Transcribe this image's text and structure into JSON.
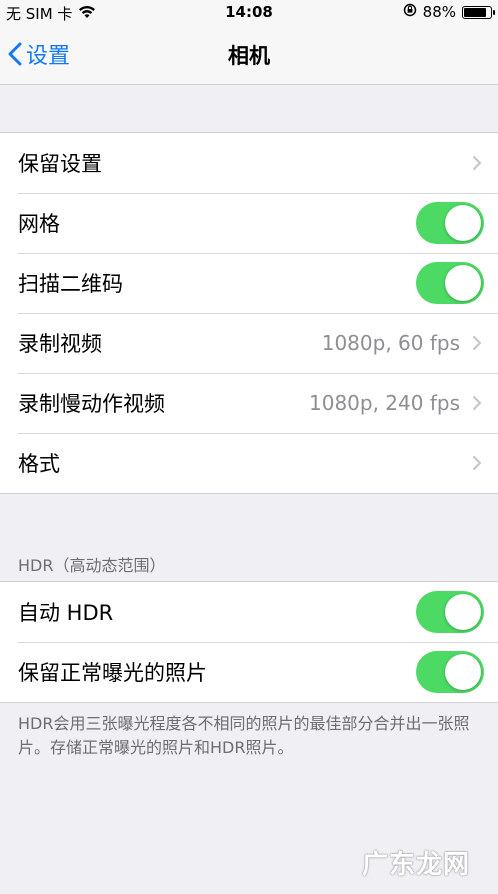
{
  "status": {
    "carrier": "无 SIM 卡",
    "time": "14:08",
    "battery": "88%",
    "battery_level": 0.88
  },
  "nav": {
    "back_label": "设置",
    "title": "相机"
  },
  "group1": {
    "rows": [
      {
        "label": "保留设置"
      },
      {
        "label": "网格",
        "on": true
      },
      {
        "label": "扫描二维码",
        "on": true
      },
      {
        "label": "录制视频",
        "value": "1080p, 60 fps"
      },
      {
        "label": "录制慢动作视频",
        "value": "1080p, 240 fps"
      },
      {
        "label": "格式"
      }
    ]
  },
  "hdr": {
    "header": "HDR（高动态范围）",
    "rows": [
      {
        "label": "自动 HDR",
        "on": true
      },
      {
        "label": "保留正常曝光的照片",
        "on": true
      }
    ],
    "footer": "HDR会用三张曝光程度各不相同的照片的最佳部分合并出一张照片。存储正常曝光的照片和HDR照片。"
  },
  "watermark": "广东龙网",
  "colors": {
    "accent": "#1478f5",
    "toggle_on": "#4cd964",
    "background": "#efeff4"
  }
}
